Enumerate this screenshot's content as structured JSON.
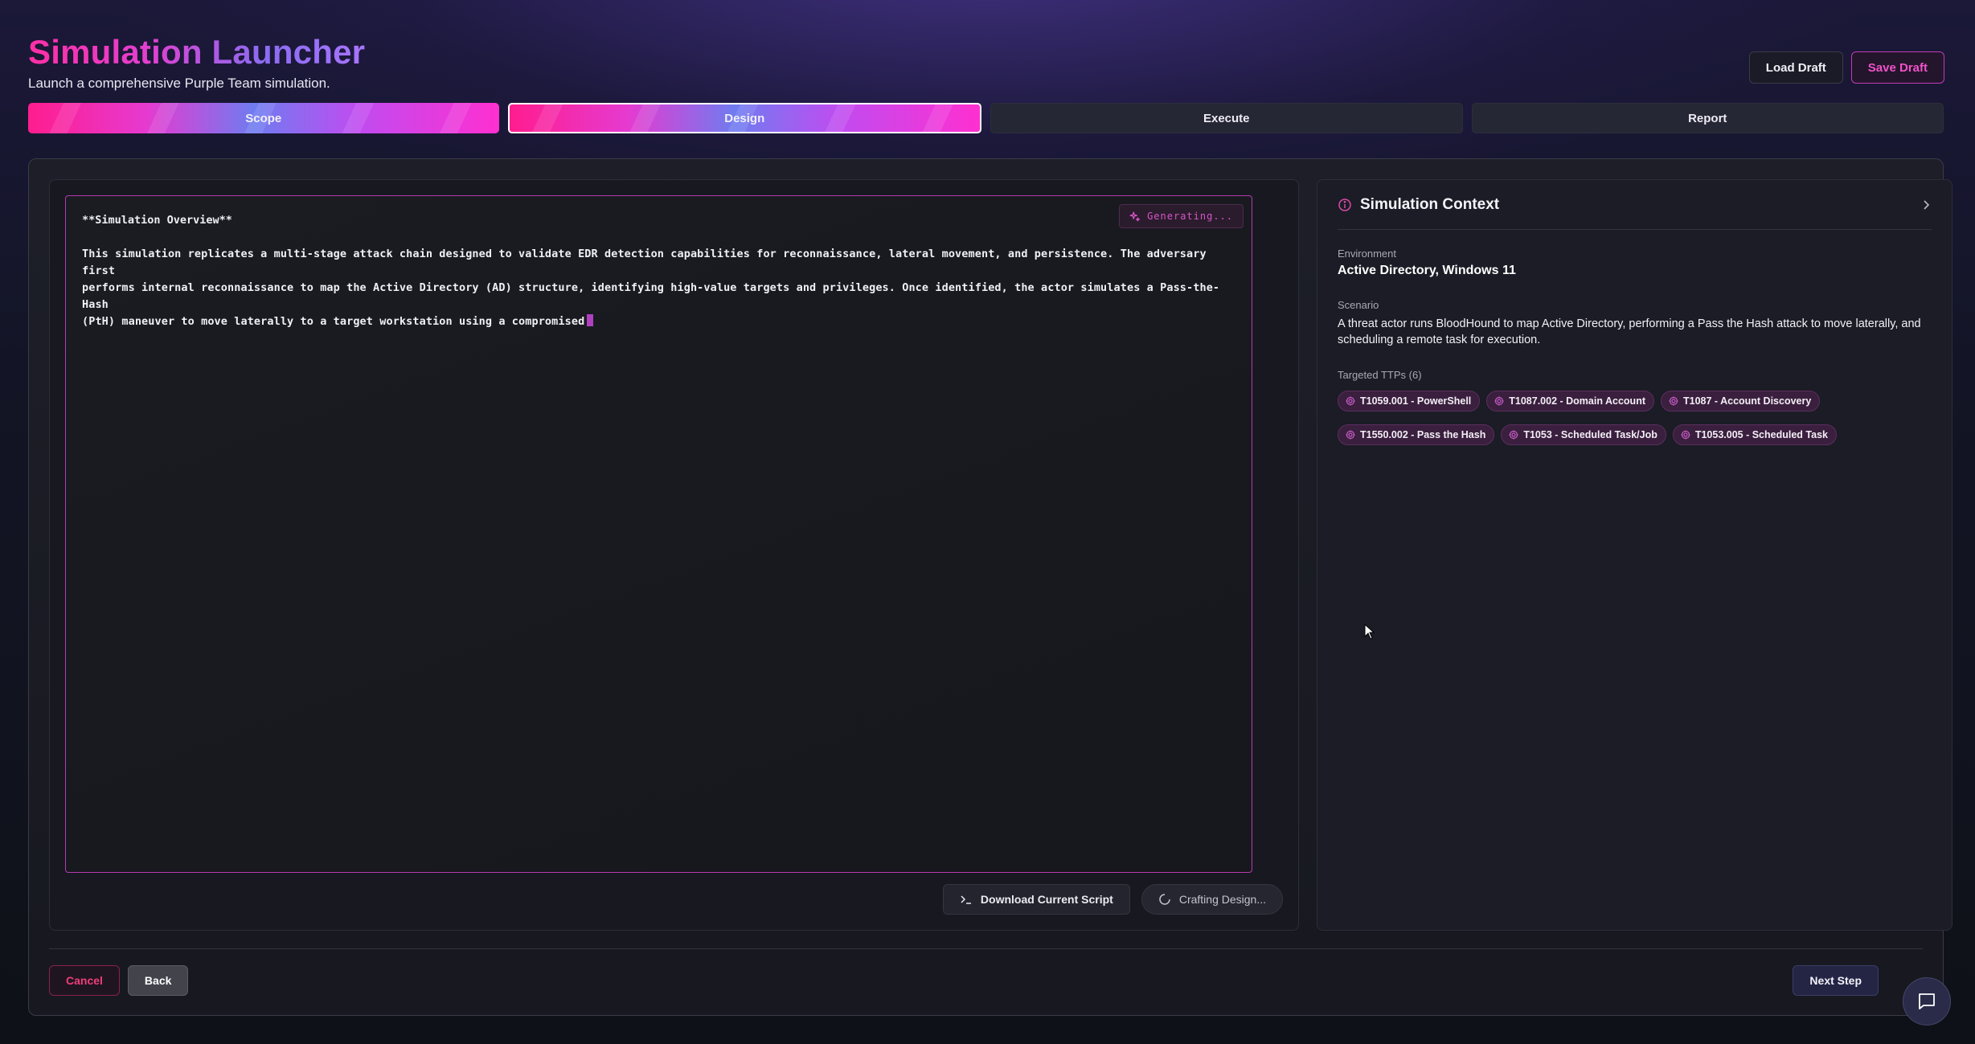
{
  "header": {
    "title": "Simulation Launcher",
    "subtitle": "Launch a comprehensive Purple Team simulation.",
    "load_draft": "Load Draft",
    "save_draft": "Save Draft"
  },
  "steps": [
    {
      "label": "Scope",
      "state": "complete"
    },
    {
      "label": "Design",
      "state": "current"
    },
    {
      "label": "Execute",
      "state": "pending"
    },
    {
      "label": "Report",
      "state": "pending"
    }
  ],
  "editor": {
    "heading": "**Simulation Overview**",
    "body": "This simulation replicates a multi-stage attack chain designed to validate EDR detection capabilities for reconnaissance, lateral movement, and persistence. The adversary first\nperforms internal reconnaissance to map the Active Directory (AD) structure, identifying high-value targets and privileges. Once identified, the actor simulates a Pass-the-Hash\n(PtH) maneuver to move laterally to a target workstation using a compromised",
    "status_badge": "Generating...",
    "download_button": "Download Current Script",
    "crafting_button": "Crafting Design..."
  },
  "context": {
    "title": "Simulation Context",
    "environment_label": "Environment",
    "environment_value": "Active Directory, Windows 11",
    "scenario_label": "Scenario",
    "scenario_value": "A threat actor runs BloodHound to map Active Directory, performing a Pass the Hash attack to move laterally, and scheduling a remote task for execution.",
    "ttps_label": "Targeted TTPs (6)",
    "ttps": [
      "T1059.001 - PowerShell",
      "T1087.002 - Domain Account",
      "T1087 - Account Discovery",
      "T1550.002 - Pass the Hash",
      "T1053 - Scheduled Task/Job",
      "T1053.005 - Scheduled Task"
    ]
  },
  "footer": {
    "cancel": "Cancel",
    "back": "Back",
    "next": "Next Step"
  },
  "colors": {
    "accent_pink": "#ff2fa5",
    "accent_purple": "#8a6cf0",
    "border_magenta": "#b63ab0"
  }
}
